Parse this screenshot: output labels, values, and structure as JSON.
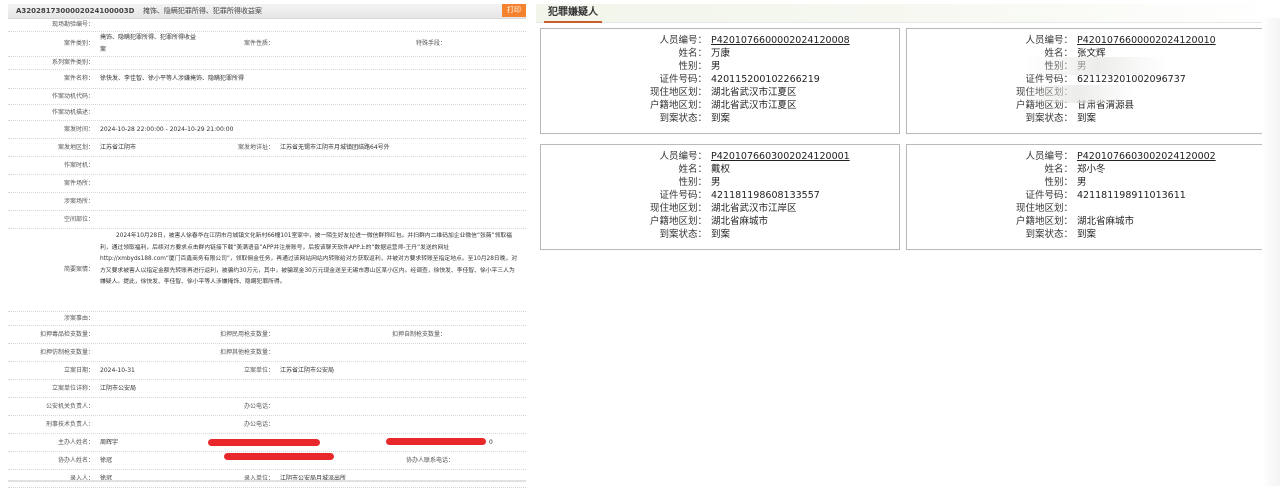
{
  "case": {
    "code": "A3202817300002024100003D",
    "title": "掩饰、隐瞒犯罪所得、犯罪所得收益案",
    "print_label": "打印"
  },
  "form": {
    "field1_label": "现场勘验编号：",
    "case_category_label": "案件类别：",
    "case_category_value": "掩饰、隐瞒犯罪所得、犯罪所得收益案",
    "case_nature_label": "案件性质：",
    "special_means_label": "特殊手段：",
    "serial_category_label": "系列案件类别：",
    "case_name_label": "案件名称：",
    "case_name_value": "徐快发、李佳智、徐小平等人涉嫌掩饰、隐瞒犯罪所得",
    "motive_label": "作案动机代码：",
    "motive_desc_label": "作案动机描述：",
    "time_label": "案发时间：",
    "time_value": "2024-10-28 22:00:00 - 2024-10-29 21:00:00",
    "region_label": "案发地区划：",
    "region_value": "江苏省江阴市",
    "address_label": "案发地详址：",
    "address_value": "江苏省无锡市江阴市月城镇团结路64号外",
    "crime_time_label": "作案时机：",
    "place_label": "案件场所：",
    "venue_label": "涉案场所：",
    "space_label": "空间部位：",
    "brief_label": "简要案情：",
    "brief_value": "2024年10月28日，被害人徐春华在江阴市月城镇文化新村66幢101室家中，被一陌生好友拉进一微信群称红包。并扫群内二维码加企业微信“张薇”领取福利，通过领取福利，后续对方要求点击群内链接下载“美满语音”APP并注册账号，后按该聊天软件APP上的“数据运营师-王丹”发送的网址http://xmbyds188.com“厦门百鑫商务有限公司”，领取佣金任务，再通过该网站网站内转账给对方获取返利，并被对方要求转账至指定地点。至10月28日晚，对方又要求被害人以指定金额先转账再进行返利，被骗约30万元，其中，被骗现金30万元现金送至无锡市惠山区某小区内。经调查，徐快发、李佳智、徐小平三人为嫌疑人。提此，徐快发、李佳智、徐小平等人涉嫌掩饰、隐瞒犯罪所得。",
    "reason_label": "涉案事由：",
    "seize_drug_label": "扣押毒品检支数量：",
    "seize_gun_label": "扣押民用枪支数量：",
    "seize_self_label": "扣押自制枪支数量：",
    "seize_imitation_label": "扣押仿制枪支数量：",
    "seize_other_label": "扣押其他枪支数量：",
    "filing_date_label": "立案日期：",
    "filing_date_value": "2024-10-31",
    "filing_unit_label": "立案单位：",
    "filing_unit_value": "江苏省江阴市公安局",
    "filing_unit_detail_label": "立案单位详称：",
    "filing_unit_detail_value": "江阴市公安局",
    "leader_label": "公安机关负责人：",
    "phone1_label": "办公电话：",
    "tech_leader_label": "刑事技术负责人：",
    "phone2_label": "办公电话：",
    "host_label": "主办人姓名：",
    "host_value": "周辉宇",
    "host_tail": "0",
    "co_label": "协办人姓名：",
    "co_value": "徐冠",
    "co_phone_label": "协办人联系电话：",
    "entry_label": "录入人：",
    "entry_value": "徐冠",
    "entry_unit_label": "录入单位：",
    "entry_unit_value": "江阴市公安局月城派出所"
  },
  "suspects_tab": "犯罪嫌疑人",
  "suspects": [
    {
      "id_label": "人员编号：",
      "id": "P4201076600002024120008",
      "name_label": "姓名：",
      "name": "万康",
      "sex_label": "性别：",
      "sex": "男",
      "cert_label": "证件号码：",
      "cert": "420115200102266219",
      "cur_label": "现住地区划：",
      "cur": "湖北省武汉市江夏区",
      "reg_label": "户籍地区划：",
      "reg": "湖北省武汉市江夏区",
      "status_label": "到案状态：",
      "status": "到案"
    },
    {
      "id_label": "人员编号：",
      "id": "P4201076600002024120010",
      "name_label": "姓名：",
      "name": "张文辉",
      "sex_label": "性别：",
      "sex": "男",
      "cert_label": "证件号码：",
      "cert": "621123201002096737",
      "cur_label": "现住地区划：",
      "cur": "",
      "reg_label": "户籍地区划：",
      "reg": "甘肃省渭源县",
      "status_label": "到案状态：",
      "status": "到案"
    },
    {
      "id_label": "人员编号：",
      "id": "P4201076603002024120001",
      "name_label": "姓名：",
      "name": "戴权",
      "sex_label": "性别：",
      "sex": "男",
      "cert_label": "证件号码：",
      "cert": "421181198608133557",
      "cur_label": "现住地区划：",
      "cur": "湖北省武汉市江岸区",
      "reg_label": "户籍地区划：",
      "reg": "湖北省麻城市",
      "status_label": "到案状态：",
      "status": "到案"
    },
    {
      "id_label": "人员编号：",
      "id": "P4201076603002024120002",
      "name_label": "姓名：",
      "name": "郑小冬",
      "sex_label": "性别：",
      "sex": "男",
      "cert_label": "证件号码：",
      "cert": "421181198911013611",
      "cur_label": "现住地区划：",
      "cur": "",
      "reg_label": "户籍地区划：",
      "reg": "湖北省麻城市",
      "status_label": "到案状态：",
      "status": "到案"
    }
  ],
  "colors": {
    "accent": "#f5822e",
    "tab_underline": "#c6602b",
    "redaction": "#e8282a"
  }
}
